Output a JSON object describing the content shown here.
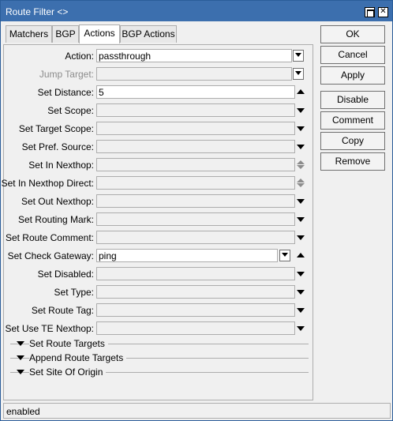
{
  "window": {
    "title": "Route Filter <>"
  },
  "tabs": [
    {
      "label": "Matchers"
    },
    {
      "label": "BGP"
    },
    {
      "label": "Actions"
    },
    {
      "label": "BGP Actions"
    }
  ],
  "active_tab": "Actions",
  "fields": {
    "action": {
      "label": "Action:",
      "value": "passthrough"
    },
    "jump_target": {
      "label": "Jump Target:",
      "value": ""
    },
    "set_distance": {
      "label": "Set Distance:",
      "value": "5"
    },
    "set_scope": {
      "label": "Set Scope:",
      "value": ""
    },
    "set_target_scope": {
      "label": "Set Target Scope:",
      "value": ""
    },
    "set_pref_source": {
      "label": "Set Pref. Source:",
      "value": ""
    },
    "set_in_nexthop": {
      "label": "Set In Nexthop:",
      "value": ""
    },
    "set_in_nexthop_direct": {
      "label": "Set In Nexthop Direct:",
      "value": ""
    },
    "set_out_nexthop": {
      "label": "Set Out Nexthop:",
      "value": ""
    },
    "set_routing_mark": {
      "label": "Set Routing Mark:",
      "value": ""
    },
    "set_route_comment": {
      "label": "Set Route Comment:",
      "value": ""
    },
    "set_check_gateway": {
      "label": "Set Check Gateway:",
      "value": "ping"
    },
    "set_disabled": {
      "label": "Set Disabled:",
      "value": ""
    },
    "set_type": {
      "label": "Set Type:",
      "value": ""
    },
    "set_route_tag": {
      "label": "Set Route Tag:",
      "value": ""
    },
    "set_use_te_nexthop": {
      "label": "Set Use TE Nexthop:",
      "value": ""
    }
  },
  "sections": {
    "set_route_targets": "Set Route Targets",
    "append_route_targets": "Append Route Targets",
    "set_site_of_origin": "Set Site Of Origin"
  },
  "buttons": {
    "ok": "OK",
    "cancel": "Cancel",
    "apply": "Apply",
    "disable": "Disable",
    "comment": "Comment",
    "copy": "Copy",
    "remove": "Remove"
  },
  "status": "enabled",
  "icons": {
    "maximize": "maximize-icon",
    "close": "close-icon",
    "dropdown": "dropdown-arrow-icon",
    "expand": "expand-arrow-icon",
    "collapse": "collapse-arrow-icon"
  },
  "colors": {
    "titlebar": "#3c6fae",
    "window_bg": "#f0f0f0",
    "disabled_label": "#8c8c8c"
  }
}
